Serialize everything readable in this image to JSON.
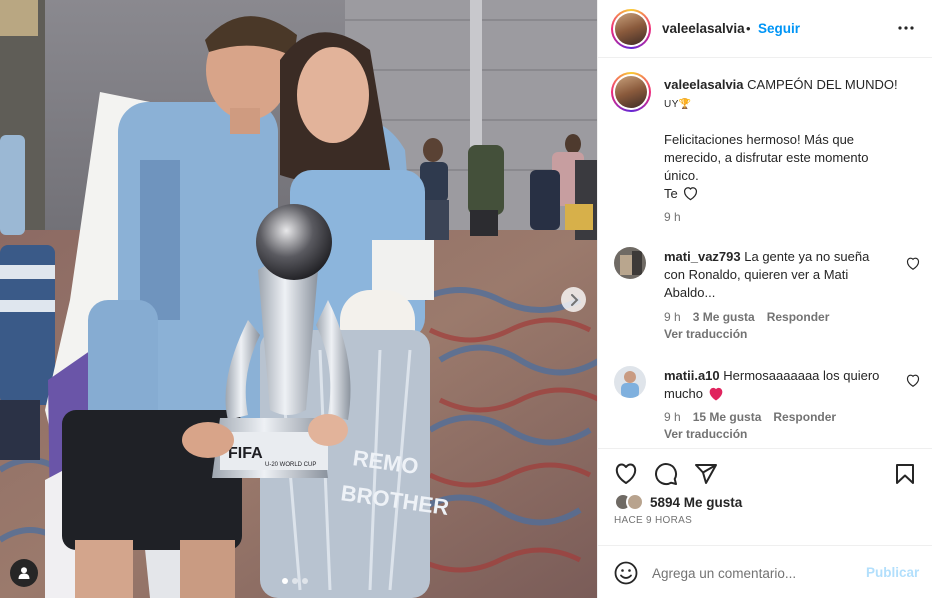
{
  "post": {
    "username": "valeelasalvia",
    "separator": "•",
    "follow_label": "Seguir",
    "more_icon": "more-options-icon",
    "image_alt": "Photo of two people holding the FIFA U-20 World Cup trophy",
    "carousel_dots": 3,
    "carousel_active": 0
  },
  "photo_overlay": {
    "trophy_text_1": "FIFA",
    "trophy_text_2": "U-20 WORLD CUP",
    "jeans_text_1": "REMO",
    "jeans_text_2": "BROTHER"
  },
  "caption": {
    "username": "valeelasalvia",
    "text": "CAMPEÓN DEL MUNDO!",
    "flag_text": "UY🏆",
    "body_line1": "Felicitaciones hermoso! Más que",
    "body_line2": "merecido, a disfrutar este momento",
    "body_line3": "único.",
    "body_line4": "Te",
    "time": "9 h"
  },
  "comments": [
    {
      "username": "mati_vaz793",
      "line1": "La gente ya no sueña",
      "line2": "con Ronaldo, quieren ver a Mati",
      "line3": "Abaldo...",
      "time": "9 h",
      "likes": "3 Me gusta",
      "reply": "Responder",
      "translate": "Ver traducción"
    },
    {
      "username": "matii.a10",
      "line1": "Hermosaaaaaaa los quiero",
      "line2": "mucho",
      "time": "9 h",
      "likes": "15 Me gusta",
      "reply": "Responder",
      "translate": "Ver traducción"
    }
  ],
  "actions": {
    "like_icon": "heart-icon",
    "comment_icon": "comment-icon",
    "share_icon": "share-icon",
    "save_icon": "bookmark-icon",
    "likes_count": "5894 Me gusta",
    "posted_ago": "HACE 9 HORAS"
  },
  "composer": {
    "placeholder": "Agrega un comentario...",
    "post_label": "Publicar"
  },
  "colors": {
    "link_blue": "#0095f6",
    "post_disabled": "#b2dffc",
    "heart_red": "#ed4956",
    "text": "#262626",
    "muted": "#737373"
  }
}
